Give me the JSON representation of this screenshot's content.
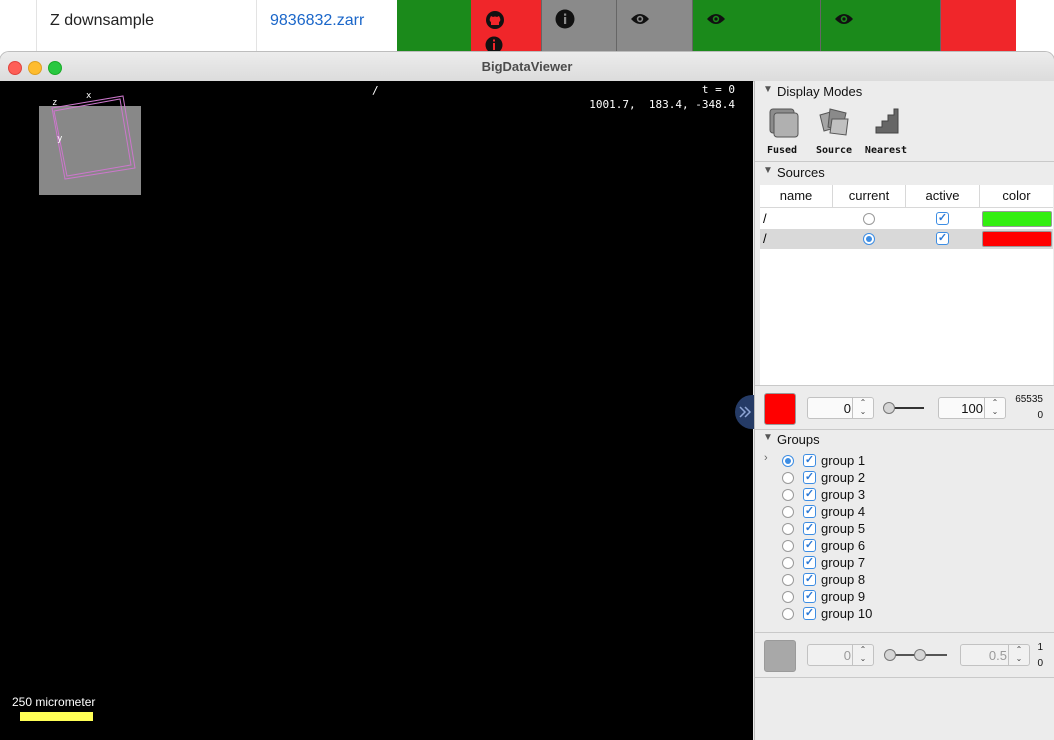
{
  "webtable": {
    "row_name": "Z downsample",
    "row_link": "9836832.zarr"
  },
  "window": {
    "title": "BigDataViewer"
  },
  "viewer": {
    "source_name": "/",
    "time": "t = 0",
    "coords": "1001.7,  183.4, -348.4",
    "axis_x": "x",
    "axis_y": "y",
    "axis_z": "z",
    "scale_label": "250 micrometer",
    "scale_color": "#ffff55"
  },
  "display_modes": {
    "title": "Display Modes",
    "modes": [
      {
        "label": "Fused",
        "icon": "fused-icon"
      },
      {
        "label": "Source",
        "icon": "source-icon"
      },
      {
        "label": "Nearest",
        "icon": "nearest-icon"
      }
    ]
  },
  "sources": {
    "title": "Sources",
    "columns": [
      "name",
      "current",
      "active",
      "color"
    ],
    "rows": [
      {
        "name": "/",
        "current": false,
        "active": true,
        "color": "#33ee11"
      },
      {
        "name": "/",
        "current": true,
        "active": true,
        "color": "#ff0000"
      }
    ],
    "control": {
      "color": "#ff0000",
      "min": "0",
      "max": "100",
      "range_max": "65535",
      "range_min": "0"
    }
  },
  "groups": {
    "title": "Groups",
    "items": [
      {
        "label": "group 1",
        "current": true,
        "active": true
      },
      {
        "label": "group 2",
        "current": false,
        "active": true
      },
      {
        "label": "group 3",
        "current": false,
        "active": true
      },
      {
        "label": "group 4",
        "current": false,
        "active": true
      },
      {
        "label": "group 5",
        "current": false,
        "active": true
      },
      {
        "label": "group 6",
        "current": false,
        "active": true
      },
      {
        "label": "group 7",
        "current": false,
        "active": true
      },
      {
        "label": "group 8",
        "current": false,
        "active": true
      },
      {
        "label": "group 9",
        "current": false,
        "active": true
      },
      {
        "label": "group 10",
        "current": false,
        "active": true
      }
    ],
    "control": {
      "color": "#a8a8a8",
      "min": "0",
      "max": "0.5",
      "range_max": "1",
      "range_min": "0"
    }
  }
}
